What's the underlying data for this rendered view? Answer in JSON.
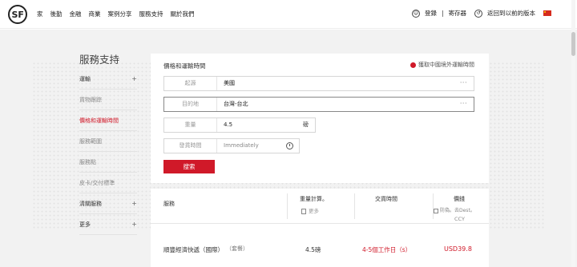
{
  "logo": {
    "text": "SF"
  },
  "nav": {
    "items": [
      "家",
      "後勤",
      "金融",
      "商業",
      "案例分享",
      "服務支持",
      "關於我們"
    ]
  },
  "header_right": {
    "login": "登錄",
    "separator": "|",
    "register": "寄存器",
    "old_version": "返回到以前的版本"
  },
  "sidebar": {
    "title": "服務支持",
    "items": [
      {
        "label": "運輸",
        "plus": "+"
      },
      {
        "label": "貨物跟踪",
        "plus": ""
      },
      {
        "label": "價格和運輸時間",
        "plus": ""
      },
      {
        "label": "服務範圍",
        "plus": ""
      },
      {
        "label": "服務點",
        "plus": ""
      },
      {
        "label": "皮卡/交付標準",
        "plus": ""
      },
      {
        "label": "清關服務",
        "plus": "+"
      },
      {
        "label": "更多",
        "plus": "+"
      }
    ]
  },
  "form": {
    "title": "價格和運輸時間",
    "link": "獲取中國境外運輸時間",
    "origin_label": "起源",
    "origin_value": "美國",
    "origin_more": "···",
    "dest_label": "目的地",
    "dest_value": "台灣-台北",
    "dest_more": "···",
    "weight_label": "重量",
    "weight_value": "4.5",
    "weight_unit": "磅",
    "ship_label": "發貨時間",
    "ship_placeholder": "Immediately",
    "search_button": "搜索"
  },
  "results": {
    "headers": {
      "service": "服務",
      "weight": "重量計算。",
      "weight_more": "更多",
      "time": "交貨時間",
      "price": "價錢",
      "price_note1": "防偽。去Dest。",
      "price_note2": "CCY"
    },
    "rows": [
      {
        "service": "順豐經濟快遞（國際）",
        "tag": "（套餐）",
        "weight": "4.5磅",
        "time": "4-5個工作日（s）",
        "price": "USD39.8"
      }
    ]
  },
  "colors": {
    "accent": "#d01929"
  }
}
